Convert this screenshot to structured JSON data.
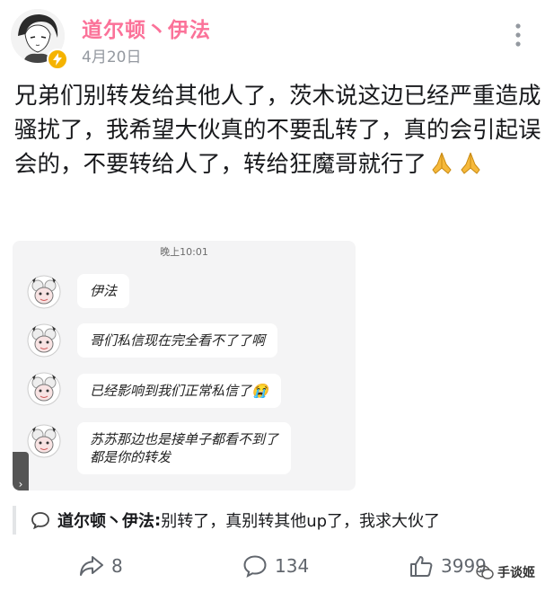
{
  "post": {
    "author": "道尔顿丶伊法",
    "date": "4月20日",
    "text": "兄弟们别转发给其他人了，茨木说这边已经严重造成骚扰了，我希望大伙真的不要乱转了，真的会引起误会的，不要转给人了，转给狂魔哥就行了",
    "emoji": "pray-icon"
  },
  "screenshot": {
    "time": "晚上10:01",
    "messages": [
      "伊法",
      "哥们私信现在完全看不了了啊",
      "已经影响到我们正常私信了😭",
      "苏苏那边也是接单子都看不到了",
      "都是你的转发"
    ]
  },
  "comment": {
    "author": "道尔顿丶伊法",
    "separator": ":",
    "text": " 别转了，真别转其他up了，我求大伙了"
  },
  "actions": {
    "share_count": "8",
    "reply_count": "134",
    "like_count": "3999"
  },
  "watermark": {
    "label": "手谈姬"
  },
  "colors": {
    "username": "#fb7299",
    "vip": "#f5b300",
    "muted": "#9499a0"
  }
}
